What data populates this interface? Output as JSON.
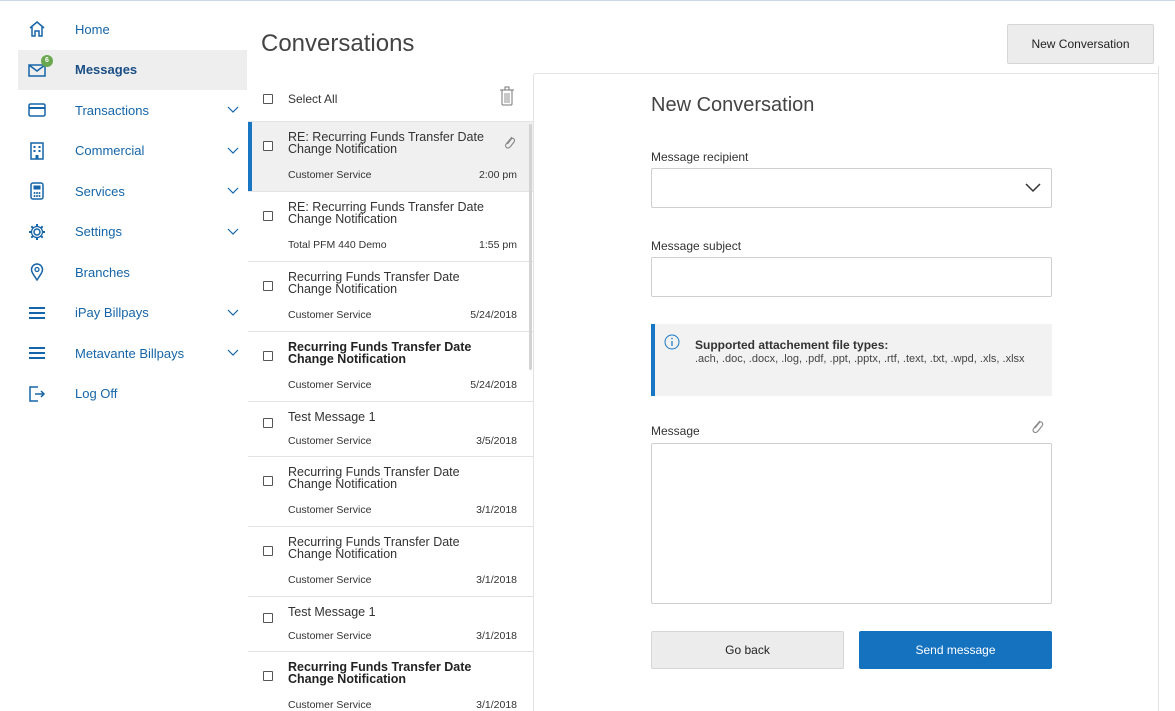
{
  "colors": {
    "accent": "#1976c2",
    "link": "#1565a8",
    "badge": "#6aa84f",
    "send_button": "#1572bf"
  },
  "sidebar": {
    "items": [
      {
        "label": "Home",
        "icon": "home-icon",
        "expandable": false
      },
      {
        "label": "Messages",
        "icon": "envelope-icon",
        "expandable": false,
        "active": true,
        "badge": "6"
      },
      {
        "label": "Transactions",
        "icon": "credit-card-icon",
        "expandable": true
      },
      {
        "label": "Commercial",
        "icon": "building-icon",
        "expandable": true
      },
      {
        "label": "Services",
        "icon": "calculator-icon",
        "expandable": true
      },
      {
        "label": "Settings",
        "icon": "gear-icon",
        "expandable": true
      },
      {
        "label": "Branches",
        "icon": "map-pin-icon",
        "expandable": false
      },
      {
        "label": "iPay Billpays",
        "icon": "menu-lines-icon",
        "expandable": true
      },
      {
        "label": "Metavante Billpays",
        "icon": "menu-lines-icon",
        "expandable": true
      },
      {
        "label": "Log Off",
        "icon": "logout-icon",
        "expandable": false
      }
    ]
  },
  "conversations": {
    "title": "Conversations",
    "new_button": "New Conversation",
    "select_all": "Select All",
    "messages": [
      {
        "subject": "RE: Recurring Funds Transfer Date Change Notification",
        "sender": "Customer Service",
        "date": "2:00 pm",
        "bold": false,
        "selected": true,
        "attachment": true
      },
      {
        "subject": "RE: Recurring Funds Transfer Date Change Notification",
        "sender": "Total PFM 440 Demo",
        "date": "1:55 pm",
        "bold": false,
        "selected": false,
        "attachment": false
      },
      {
        "subject": "Recurring Funds Transfer Date Change Notification",
        "sender": "Customer Service",
        "date": "5/24/2018",
        "bold": false,
        "selected": false,
        "attachment": false
      },
      {
        "subject": "Recurring Funds Transfer Date Change Notification",
        "sender": "Customer Service",
        "date": "5/24/2018",
        "bold": true,
        "selected": false,
        "attachment": false
      },
      {
        "subject": "Test Message 1",
        "sender": "Customer Service",
        "date": "3/5/2018",
        "bold": false,
        "selected": false,
        "attachment": false
      },
      {
        "subject": "Recurring Funds Transfer Date Change Notification",
        "sender": "Customer Service",
        "date": "3/1/2018",
        "bold": false,
        "selected": false,
        "attachment": false
      },
      {
        "subject": "Recurring Funds Transfer Date Change Notification",
        "sender": "Customer Service",
        "date": "3/1/2018",
        "bold": false,
        "selected": false,
        "attachment": false
      },
      {
        "subject": "Test Message 1",
        "sender": "Customer Service",
        "date": "3/1/2018",
        "bold": false,
        "selected": false,
        "attachment": false
      },
      {
        "subject": "Recurring Funds Transfer Date Change Notification",
        "sender": "Customer Service",
        "date": "3/1/2018",
        "bold": true,
        "selected": false,
        "attachment": false
      }
    ]
  },
  "compose": {
    "title": "New Conversation",
    "recipient_label": "Message recipient",
    "recipient_value": "",
    "subject_label": "Message subject",
    "subject_value": "",
    "info_title": "Supported attachement file types:",
    "info_text": ".ach, .doc, .docx, .log, .pdf, .ppt, .pptx, .rtf, .text, .txt, .wpd, .xls, .xlsx",
    "message_label": "Message",
    "message_value": "",
    "back_button": "Go back",
    "send_button": "Send message"
  }
}
